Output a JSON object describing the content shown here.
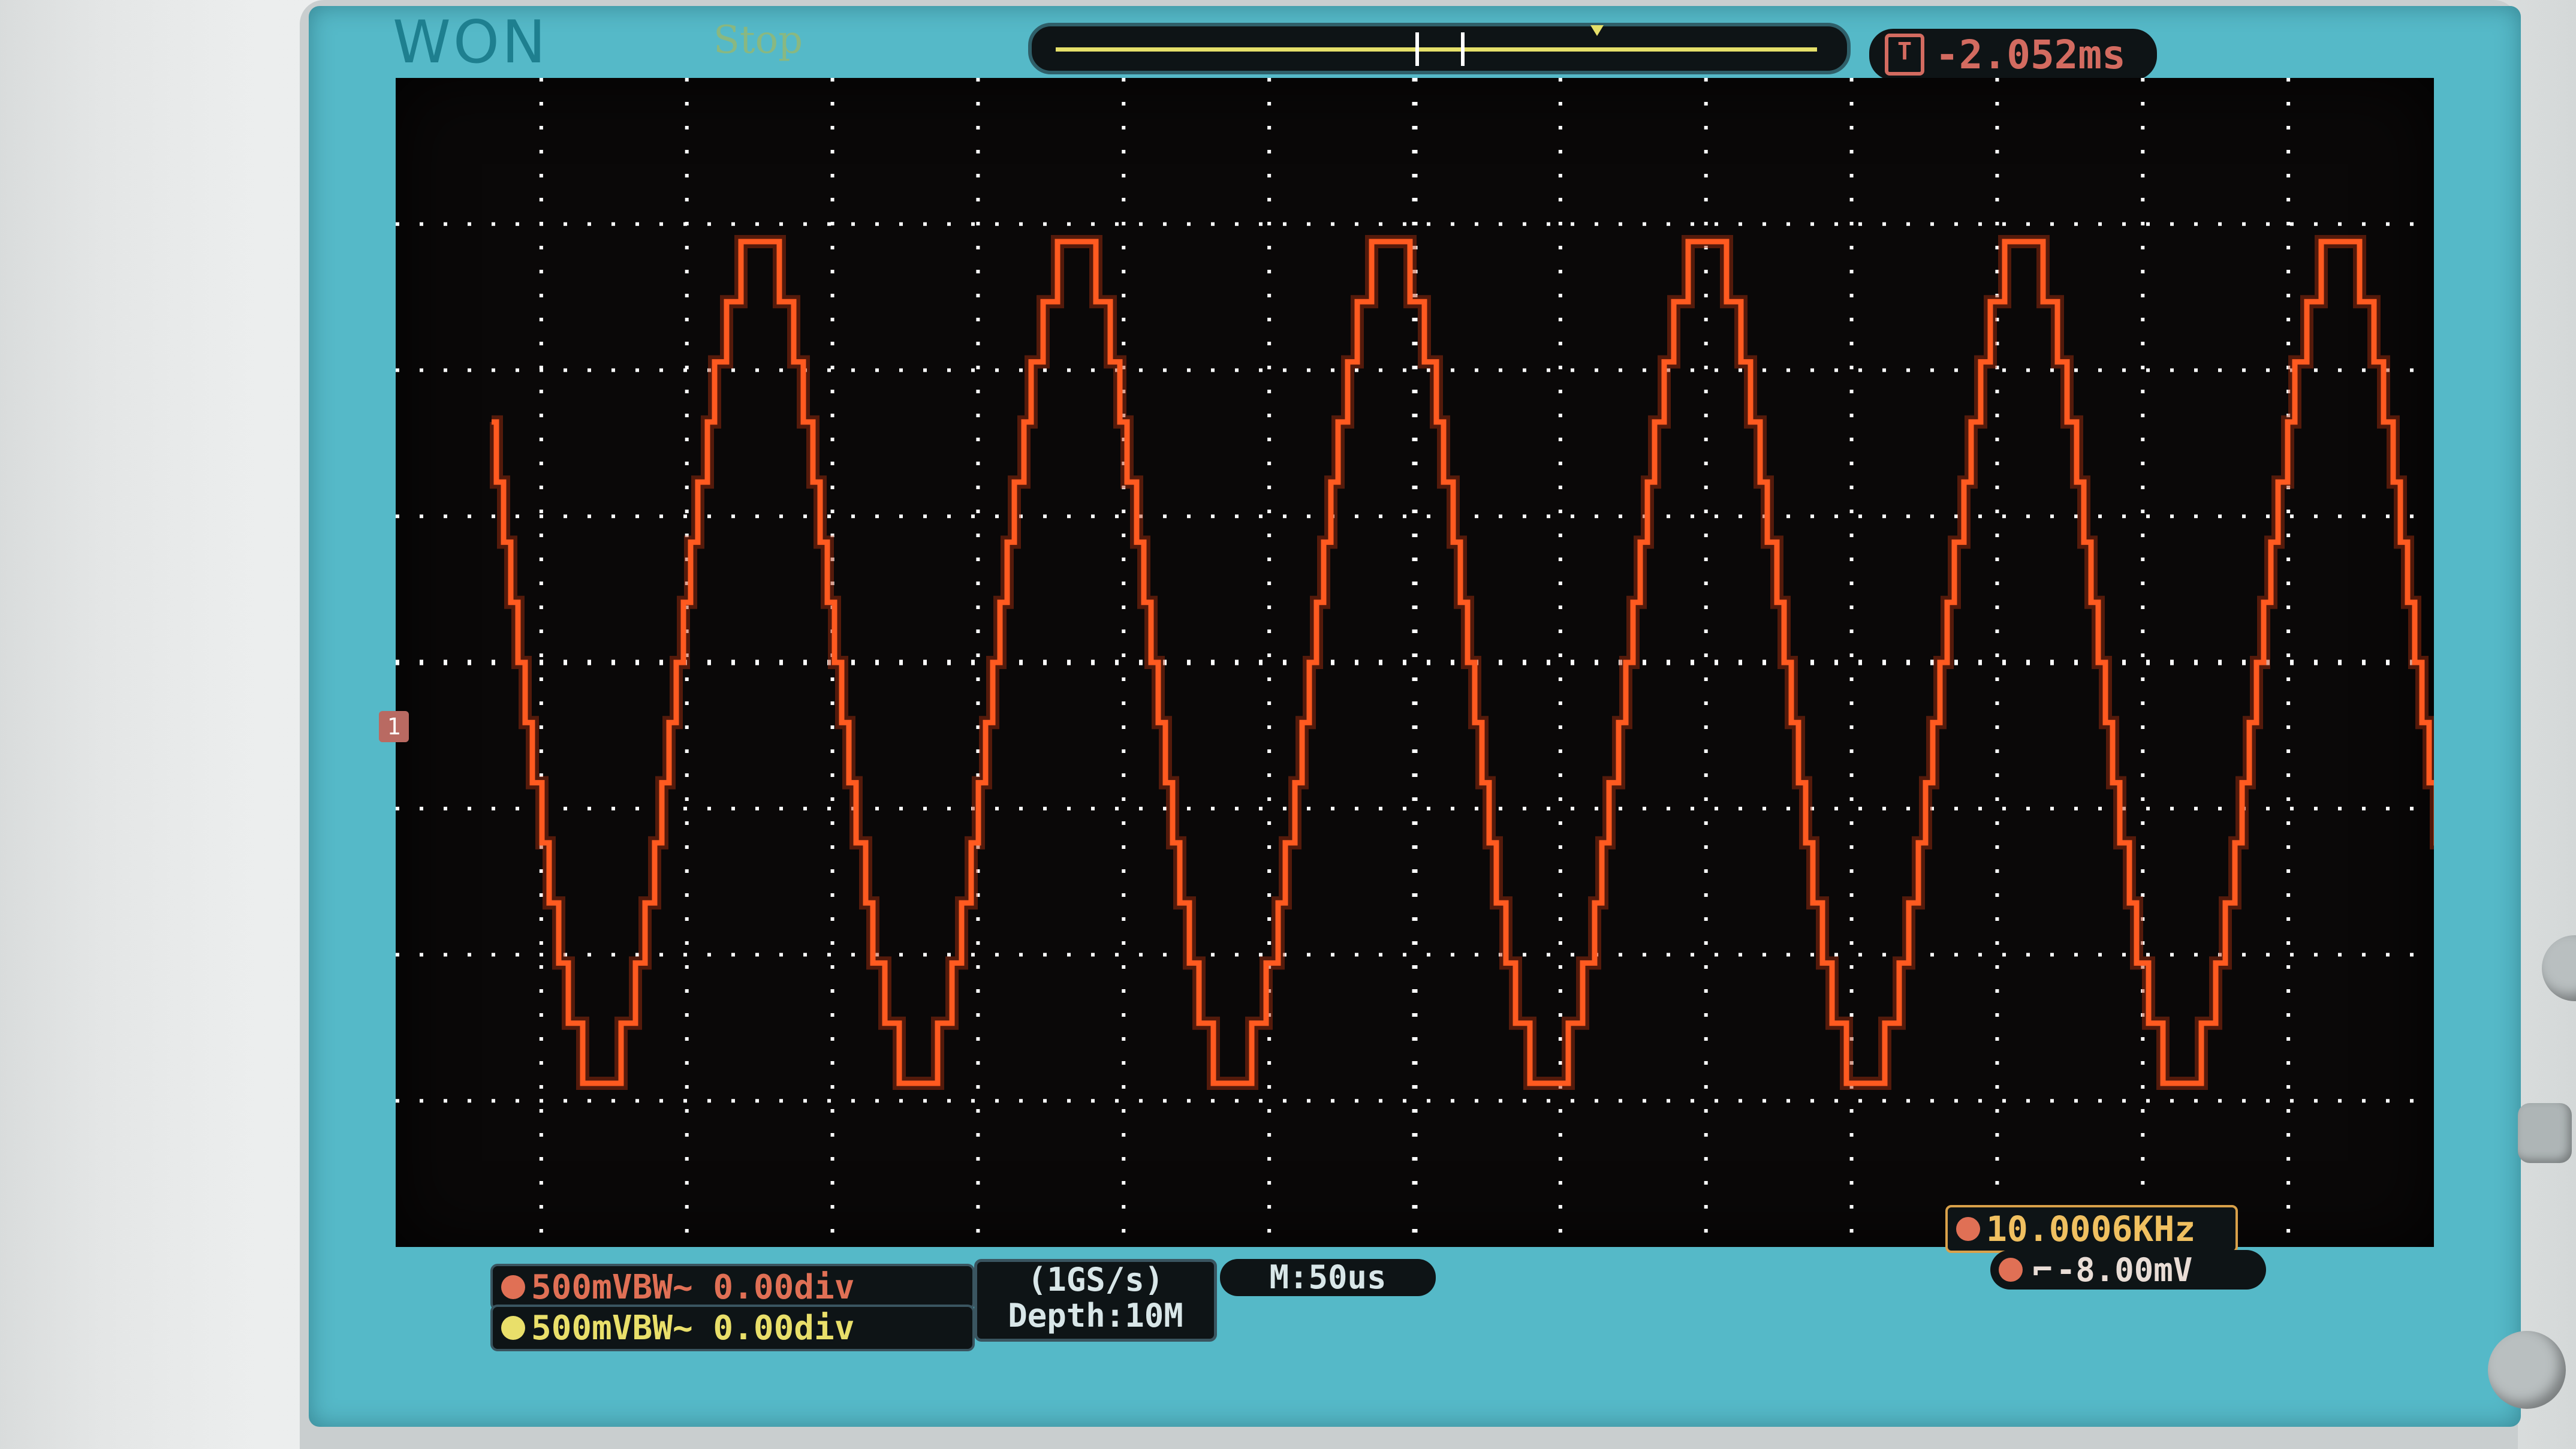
{
  "header": {
    "brand": "WON",
    "run_state": "Stop",
    "trigger_delay": "-2.052ms"
  },
  "channels": [
    {
      "name": "CH1",
      "scale_text": "500mVBW~ 0.00div",
      "color": "#e07055"
    },
    {
      "name": "CH2",
      "scale_text": "500mVBW~ 0.00div",
      "color": "#e9df6a"
    }
  ],
  "acquisition": {
    "sample_rate": "(1GS/s)",
    "depth": "Depth:10M"
  },
  "timebase": "M:50us",
  "frequency": "10.0006KHz",
  "trigger": {
    "level": "-8.00mV"
  },
  "colors": {
    "trace": "#ff5a20",
    "grid": "#ffffff",
    "screen_bg": "#0a0808",
    "frame": "#55b9c8"
  },
  "icons": [
    "trigger-delay-icon",
    "ch1-ground-marker",
    "trigger-slope-icon"
  ]
}
